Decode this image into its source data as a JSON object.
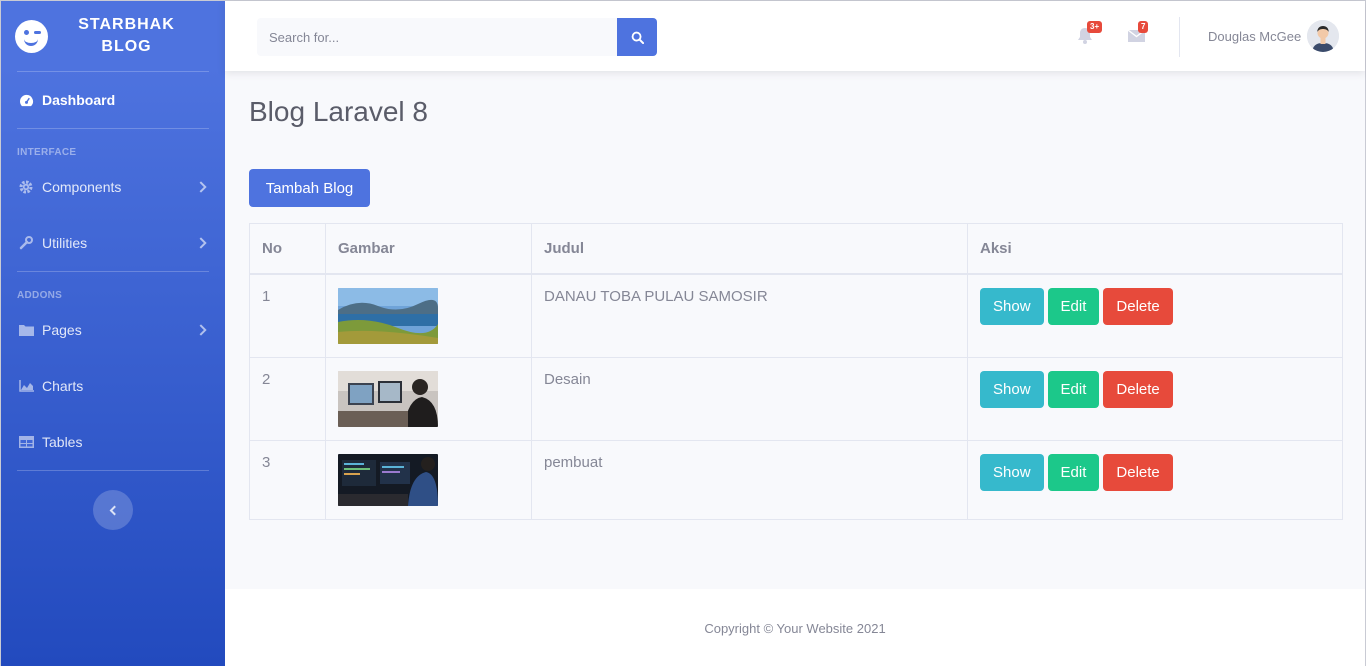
{
  "brand": {
    "line1": "STARBHAK",
    "line2": "BLOG"
  },
  "sidebar": {
    "dashboard": "Dashboard",
    "interface_heading": "INTERFACE",
    "components": "Components",
    "utilities": "Utilities",
    "addons_heading": "ADDONS",
    "pages": "Pages",
    "charts": "Charts",
    "tables": "Tables"
  },
  "topbar": {
    "search_placeholder": "Search for...",
    "alerts_badge": "3+",
    "messages_badge": "7",
    "username": "Douglas McGee"
  },
  "main": {
    "title": "Blog Laravel 8",
    "add_button": "Tambah Blog",
    "table": {
      "headers": [
        "No",
        "Gambar",
        "Judul",
        "Aksi"
      ],
      "rows": [
        {
          "no": "1",
          "judul": "DANAU TOBA PULAU SAMOSIR"
        },
        {
          "no": "2",
          "judul": "Desain"
        },
        {
          "no": "3",
          "judul": "pembuat"
        }
      ],
      "actions": {
        "show": "Show",
        "edit": "Edit",
        "delete": "Delete"
      }
    }
  },
  "footer": {
    "copyright": "Copyright © Your Website 2021"
  },
  "colors": {
    "primary": "#4e73df",
    "info": "#36b9cc",
    "success": "#1cc88a",
    "danger": "#e74a3b"
  }
}
